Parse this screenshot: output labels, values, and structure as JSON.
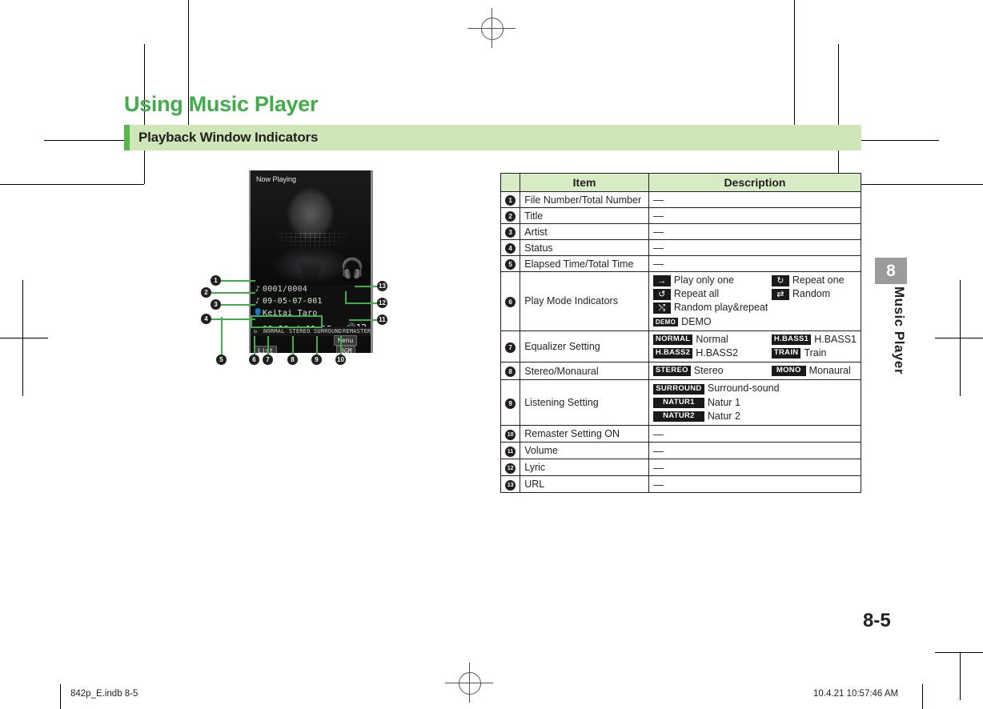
{
  "page": {
    "title": "Using Music Player",
    "section": "Playback Window Indicators",
    "chapter_number": "8",
    "chapter_name": "Music Player",
    "page_number": "8-5"
  },
  "footer": {
    "left": "842p_E.indb   8-5",
    "right": "10.4.21   10:57:46 AM"
  },
  "phone": {
    "now_playing": "Now Playing",
    "file_number": "0001/0004",
    "title": "09-05-07-001",
    "artist": "Keitai Taro",
    "elapsed": "00:20",
    "separator": "/",
    "total": "01:15",
    "volume": "12",
    "play_icon": "play-icon",
    "note_icon": "music-note-icon",
    "person_icon": "person-icon",
    "file_icon": "file-icon",
    "headphone_icon": "headphone-icon",
    "speaker_icon": "speaker-icon",
    "lyric_icon": "lyric-icon",
    "url_icon": "url-icon",
    "status_icons": [
      "repeat-all-icon"
    ],
    "status_labels": [
      "NORMAL",
      "STEREO",
      "SURROUND",
      "REMASTER"
    ],
    "softkeys": {
      "left": "List",
      "right_top": "Menu",
      "right_bottom": "BGM"
    }
  },
  "callouts": [
    "1",
    "2",
    "3",
    "4",
    "5",
    "6",
    "7",
    "8",
    "9",
    "10",
    "11",
    "12",
    "13"
  ],
  "table": {
    "headers": [
      "",
      "Item",
      "Description"
    ],
    "rows": [
      {
        "num": "1",
        "item": "File Number/Total Number",
        "desc": "—"
      },
      {
        "num": "2",
        "item": "Title",
        "desc": "—"
      },
      {
        "num": "3",
        "item": "Artist",
        "desc": "—"
      },
      {
        "num": "4",
        "item": "Status",
        "desc": "—"
      },
      {
        "num": "5",
        "item": "Elapsed Time/Total Time",
        "desc": "—"
      },
      {
        "num": "6",
        "item": "Play Mode Indicators",
        "desc": ""
      },
      {
        "num": "7",
        "item": "Equalizer Setting",
        "desc": ""
      },
      {
        "num": "8",
        "item": "Stereo/Monaural",
        "desc": ""
      },
      {
        "num": "9",
        "item": "Listening Setting",
        "desc": ""
      },
      {
        "num": "10",
        "item": "Remaster Setting ON",
        "desc": "—"
      },
      {
        "num": "11",
        "item": "Volume",
        "desc": "—"
      },
      {
        "num": "12",
        "item": "Lyric",
        "desc": "—"
      },
      {
        "num": "13",
        "item": "URL",
        "desc": "—"
      }
    ],
    "play_mode": {
      "col_a": [
        {
          "icon": "arrow-right-icon",
          "glyph": "→",
          "label": "Play only one"
        },
        {
          "icon": "repeat-all-icon",
          "glyph": "↺",
          "label": "Repeat all"
        },
        {
          "icon": "random-repeat-icon",
          "glyph": "⤭",
          "label": "Random play&repeat"
        },
        {
          "icon": "demo-badge",
          "glyph": "DEMO",
          "label": "DEMO"
        }
      ],
      "col_b": [
        {
          "icon": "repeat-one-icon",
          "glyph": "↻",
          "label": "Repeat one"
        },
        {
          "icon": "shuffle-icon",
          "glyph": "⇄",
          "label": "Random"
        }
      ]
    },
    "equalizer": {
      "col_a": [
        {
          "badge": "NORMAL",
          "label": "Normal"
        },
        {
          "badge": "H.BASS2",
          "label": "H.BASS2"
        }
      ],
      "col_b": [
        {
          "badge": "H.BASS1",
          "label": "H.BASS1"
        },
        {
          "badge": "TRAIN",
          "label": "Train"
        }
      ]
    },
    "stereo": {
      "col_a": [
        {
          "badge": "STEREO",
          "label": "Stereo"
        }
      ],
      "col_b": [
        {
          "badge": "MONO",
          "label": "Monaural"
        }
      ]
    },
    "listening": [
      {
        "badge": "SURROUND",
        "label": "Surround-sound"
      },
      {
        "badge": "NATUR1",
        "label": "Natur 1"
      },
      {
        "badge": "NATUR2",
        "label": "Natur 2"
      }
    ]
  },
  "colors": {
    "title_green": "#3fae49",
    "band_green": "#cfe7b8",
    "accent_green": "#56b848",
    "header_green": "#d7ebc4",
    "ink": "#231f20"
  }
}
